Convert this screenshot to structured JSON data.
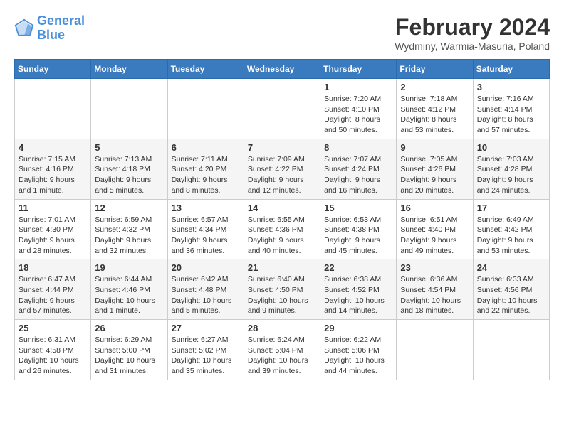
{
  "header": {
    "logo_line1": "General",
    "logo_line2": "Blue",
    "month_year": "February 2024",
    "location": "Wydminy, Warmia-Masuria, Poland"
  },
  "weekdays": [
    "Sunday",
    "Monday",
    "Tuesday",
    "Wednesday",
    "Thursday",
    "Friday",
    "Saturday"
  ],
  "rows": [
    [
      {
        "day": "",
        "info": ""
      },
      {
        "day": "",
        "info": ""
      },
      {
        "day": "",
        "info": ""
      },
      {
        "day": "",
        "info": ""
      },
      {
        "day": "1",
        "info": "Sunrise: 7:20 AM\nSunset: 4:10 PM\nDaylight: 8 hours\nand 50 minutes."
      },
      {
        "day": "2",
        "info": "Sunrise: 7:18 AM\nSunset: 4:12 PM\nDaylight: 8 hours\nand 53 minutes."
      },
      {
        "day": "3",
        "info": "Sunrise: 7:16 AM\nSunset: 4:14 PM\nDaylight: 8 hours\nand 57 minutes."
      }
    ],
    [
      {
        "day": "4",
        "info": "Sunrise: 7:15 AM\nSunset: 4:16 PM\nDaylight: 9 hours\nand 1 minute."
      },
      {
        "day": "5",
        "info": "Sunrise: 7:13 AM\nSunset: 4:18 PM\nDaylight: 9 hours\nand 5 minutes."
      },
      {
        "day": "6",
        "info": "Sunrise: 7:11 AM\nSunset: 4:20 PM\nDaylight: 9 hours\nand 8 minutes."
      },
      {
        "day": "7",
        "info": "Sunrise: 7:09 AM\nSunset: 4:22 PM\nDaylight: 9 hours\nand 12 minutes."
      },
      {
        "day": "8",
        "info": "Sunrise: 7:07 AM\nSunset: 4:24 PM\nDaylight: 9 hours\nand 16 minutes."
      },
      {
        "day": "9",
        "info": "Sunrise: 7:05 AM\nSunset: 4:26 PM\nDaylight: 9 hours\nand 20 minutes."
      },
      {
        "day": "10",
        "info": "Sunrise: 7:03 AM\nSunset: 4:28 PM\nDaylight: 9 hours\nand 24 minutes."
      }
    ],
    [
      {
        "day": "11",
        "info": "Sunrise: 7:01 AM\nSunset: 4:30 PM\nDaylight: 9 hours\nand 28 minutes."
      },
      {
        "day": "12",
        "info": "Sunrise: 6:59 AM\nSunset: 4:32 PM\nDaylight: 9 hours\nand 32 minutes."
      },
      {
        "day": "13",
        "info": "Sunrise: 6:57 AM\nSunset: 4:34 PM\nDaylight: 9 hours\nand 36 minutes."
      },
      {
        "day": "14",
        "info": "Sunrise: 6:55 AM\nSunset: 4:36 PM\nDaylight: 9 hours\nand 40 minutes."
      },
      {
        "day": "15",
        "info": "Sunrise: 6:53 AM\nSunset: 4:38 PM\nDaylight: 9 hours\nand 45 minutes."
      },
      {
        "day": "16",
        "info": "Sunrise: 6:51 AM\nSunset: 4:40 PM\nDaylight: 9 hours\nand 49 minutes."
      },
      {
        "day": "17",
        "info": "Sunrise: 6:49 AM\nSunset: 4:42 PM\nDaylight: 9 hours\nand 53 minutes."
      }
    ],
    [
      {
        "day": "18",
        "info": "Sunrise: 6:47 AM\nSunset: 4:44 PM\nDaylight: 9 hours\nand 57 minutes."
      },
      {
        "day": "19",
        "info": "Sunrise: 6:44 AM\nSunset: 4:46 PM\nDaylight: 10 hours\nand 1 minute."
      },
      {
        "day": "20",
        "info": "Sunrise: 6:42 AM\nSunset: 4:48 PM\nDaylight: 10 hours\nand 5 minutes."
      },
      {
        "day": "21",
        "info": "Sunrise: 6:40 AM\nSunset: 4:50 PM\nDaylight: 10 hours\nand 9 minutes."
      },
      {
        "day": "22",
        "info": "Sunrise: 6:38 AM\nSunset: 4:52 PM\nDaylight: 10 hours\nand 14 minutes."
      },
      {
        "day": "23",
        "info": "Sunrise: 6:36 AM\nSunset: 4:54 PM\nDaylight: 10 hours\nand 18 minutes."
      },
      {
        "day": "24",
        "info": "Sunrise: 6:33 AM\nSunset: 4:56 PM\nDaylight: 10 hours\nand 22 minutes."
      }
    ],
    [
      {
        "day": "25",
        "info": "Sunrise: 6:31 AM\nSunset: 4:58 PM\nDaylight: 10 hours\nand 26 minutes."
      },
      {
        "day": "26",
        "info": "Sunrise: 6:29 AM\nSunset: 5:00 PM\nDaylight: 10 hours\nand 31 minutes."
      },
      {
        "day": "27",
        "info": "Sunrise: 6:27 AM\nSunset: 5:02 PM\nDaylight: 10 hours\nand 35 minutes."
      },
      {
        "day": "28",
        "info": "Sunrise: 6:24 AM\nSunset: 5:04 PM\nDaylight: 10 hours\nand 39 minutes."
      },
      {
        "day": "29",
        "info": "Sunrise: 6:22 AM\nSunset: 5:06 PM\nDaylight: 10 hours\nand 44 minutes."
      },
      {
        "day": "",
        "info": ""
      },
      {
        "day": "",
        "info": ""
      }
    ]
  ]
}
